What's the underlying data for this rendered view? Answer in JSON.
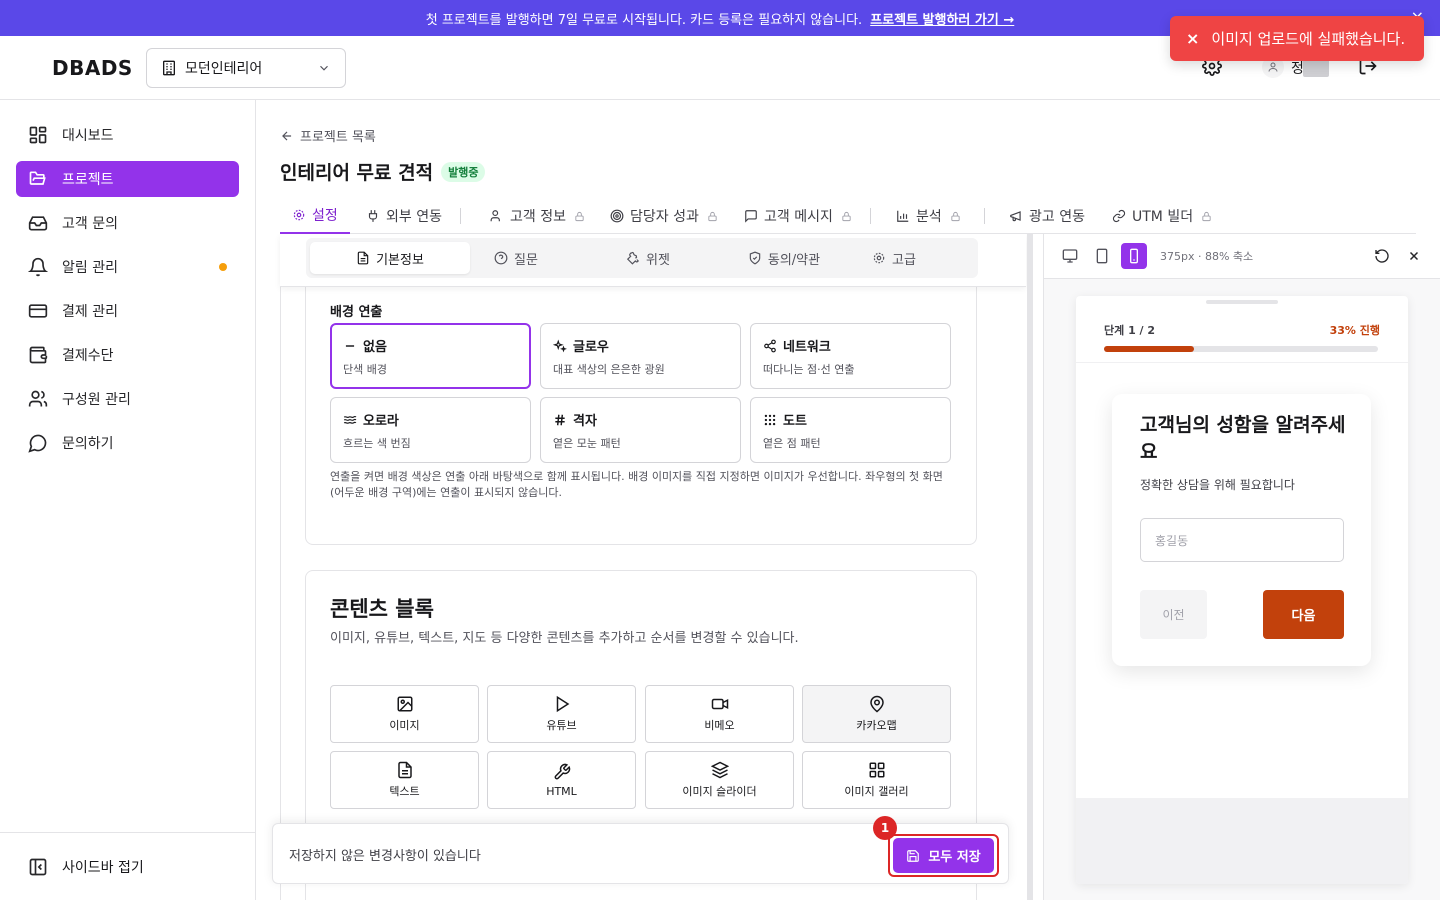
{
  "banner": {
    "text": "첫 프로젝트를 발행하면 7일 무료로 시작됩니다. 카드 등록은 필요하지 않습니다.",
    "link": "프로젝트 발행하러 가기 →",
    "close": "×"
  },
  "header": {
    "logo": "DBADS",
    "workspace": "모던인테리어",
    "user_initial": "정"
  },
  "toast": {
    "icon": "×",
    "message": "이미지 업로드에 실패했습니다."
  },
  "sidebar": {
    "items": [
      {
        "label": "대시보드",
        "icon": "dashboard-icon"
      },
      {
        "label": "프로젝트",
        "icon": "folder-icon",
        "active": true
      },
      {
        "label": "고객 문의",
        "icon": "inbox-icon"
      },
      {
        "label": "알림 관리",
        "icon": "bell-icon"
      },
      {
        "label": "결제 관리",
        "icon": "credit-card-icon"
      },
      {
        "label": "결제수단",
        "icon": "wallet-icon"
      },
      {
        "label": "구성원 관리",
        "icon": "users-icon"
      },
      {
        "label": "문의하기",
        "icon": "chat-icon"
      }
    ],
    "collapse": "사이드바 접기"
  },
  "page": {
    "back": "프로젝트 목록",
    "title": "인테리어 무료 견적",
    "status": "발행중"
  },
  "tabs": [
    "설정",
    "외부 연동",
    "고객 정보",
    "담당자 성과",
    "고객 메시지",
    "분석",
    "광고 연동",
    "UTM 빌더"
  ],
  "subtabs": [
    "기본정보",
    "질문",
    "위젯",
    "동의/약관",
    "고급"
  ],
  "background": {
    "label": "배경 연출",
    "options": [
      {
        "title": "없음",
        "desc": "단색 배경",
        "icon": "minus-icon"
      },
      {
        "title": "글로우",
        "desc": "대표 색상의 은은한 광원",
        "icon": "sparkle-icon"
      },
      {
        "title": "네트워크",
        "desc": "떠다니는 점·선 연출",
        "icon": "network-icon"
      },
      {
        "title": "오로라",
        "desc": "흐르는 색 번짐",
        "icon": "wave-icon"
      },
      {
        "title": "격자",
        "desc": "옅은 모눈 패턴",
        "icon": "hash-icon"
      },
      {
        "title": "도트",
        "desc": "옅은 점 패턴",
        "icon": "dots-icon"
      }
    ],
    "note": "연출을 켜면 배경 색상은 연출 아래 바탕색으로 함께 표시됩니다. 배경 이미지를 직접 지정하면 이미지가 우선합니다. 좌우형의 첫 화면(어두운 배경 구역)에는 연출이 표시되지 않습니다."
  },
  "content_blocks": {
    "title": "콘텐츠 블록",
    "desc": "이미지, 유튜브, 텍스트, 지도 등 다양한 콘텐츠를 추가하고 순서를 변경할 수 있습니다.",
    "items": [
      {
        "label": "이미지",
        "icon": "image-icon"
      },
      {
        "label": "유튜브",
        "icon": "play-icon"
      },
      {
        "label": "비메오",
        "icon": "video-icon"
      },
      {
        "label": "카카오맵",
        "icon": "map-pin-icon"
      },
      {
        "label": "텍스트",
        "icon": "file-text-icon"
      },
      {
        "label": "HTML",
        "icon": "wrench-icon"
      },
      {
        "label": "이미지 슬라이더",
        "icon": "layers-icon"
      },
      {
        "label": "이미지 갤러리",
        "icon": "grid-icon"
      }
    ]
  },
  "savebar": {
    "message": "저장하지 않은 변경사항이 있습니다",
    "button": "모두 저장",
    "badge": "1"
  },
  "preview": {
    "info": "375px · 88% 축소",
    "step": "단계 1 / 2",
    "progress_label": "33% 진행",
    "progress": 0.33,
    "question": "고객님의 성함을 알려주세요",
    "sub": "정확한 상담을 위해 필요합니다",
    "placeholder": "홍길동",
    "prev": "이전",
    "next": "다음"
  },
  "colors": {
    "accent": "#9333ea",
    "banner": "#5a48e8",
    "toast": "#ef4444",
    "form_accent": "#c2410c"
  }
}
